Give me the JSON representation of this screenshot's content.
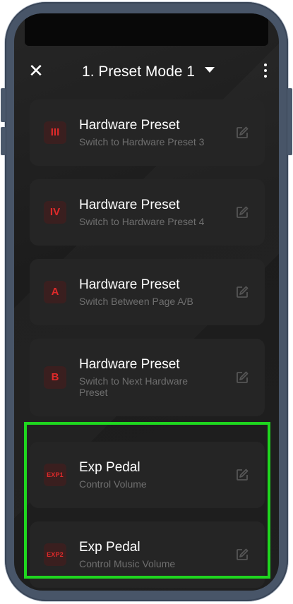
{
  "header": {
    "close_icon": "close-icon",
    "title": "1. Preset Mode 1",
    "dropdown_icon": "caret-down-icon",
    "more_icon": "more-vertical-icon"
  },
  "items": [
    {
      "badge": "III",
      "title": "Hardware Preset",
      "subtitle": "Switch to Hardware Preset 3",
      "icon": "edit-icon"
    },
    {
      "badge": "IV",
      "title": "Hardware Preset",
      "subtitle": "Switch to Hardware Preset 4",
      "icon": "edit-icon"
    },
    {
      "badge": "A",
      "title": "Hardware Preset",
      "subtitle": "Switch Between Page A/B",
      "icon": "edit-icon"
    },
    {
      "badge": "B",
      "title": "Hardware Preset",
      "subtitle": "Switch to Next Hardware Preset",
      "icon": "edit-icon"
    },
    {
      "badge": "EXP1",
      "title": "Exp Pedal",
      "subtitle": "Control Volume",
      "icon": "edit-icon"
    },
    {
      "badge": "EXP2",
      "title": "Exp Pedal",
      "subtitle": "Control Music Volume",
      "icon": "edit-icon"
    }
  ],
  "colors": {
    "badge_text": "#e02a2a",
    "highlight": "#1fd61f",
    "card_bg": "#252525",
    "phone_frame": "#485568"
  }
}
